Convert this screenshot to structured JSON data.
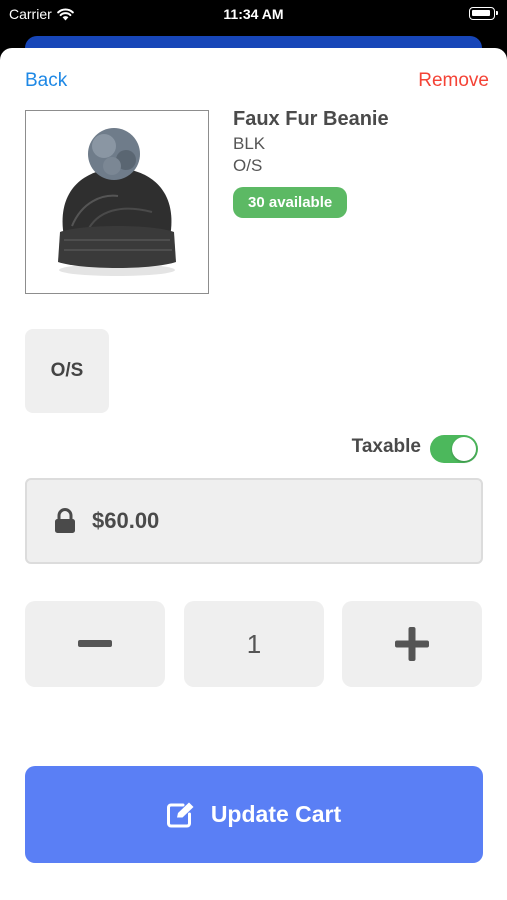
{
  "status_bar": {
    "carrier": "Carrier",
    "time": "11:34 AM"
  },
  "nav": {
    "back_label": "Back",
    "remove_label": "Remove"
  },
  "product": {
    "title": "Faux Fur Beanie",
    "color": "BLK",
    "size": "O/S",
    "stock_badge": "30 available",
    "image_icon": "beanie-hat-image"
  },
  "size_options": [
    {
      "label": "O/S",
      "selected": true
    }
  ],
  "taxable": {
    "label": "Taxable",
    "on": true
  },
  "price": {
    "value": "$60.00",
    "icon": "lock-icon"
  },
  "quantity": {
    "value": "1",
    "decrement_icon": "minus-icon",
    "increment_icon": "plus-icon"
  },
  "update_button": {
    "label": "Update Cart",
    "icon": "edit-icon"
  },
  "colors": {
    "accent_blue": "#1e88e5",
    "remove_red": "#f44336",
    "badge_green": "#5cb964",
    "toggle_green": "#4cb85c",
    "primary_button": "#5a7ff5"
  }
}
